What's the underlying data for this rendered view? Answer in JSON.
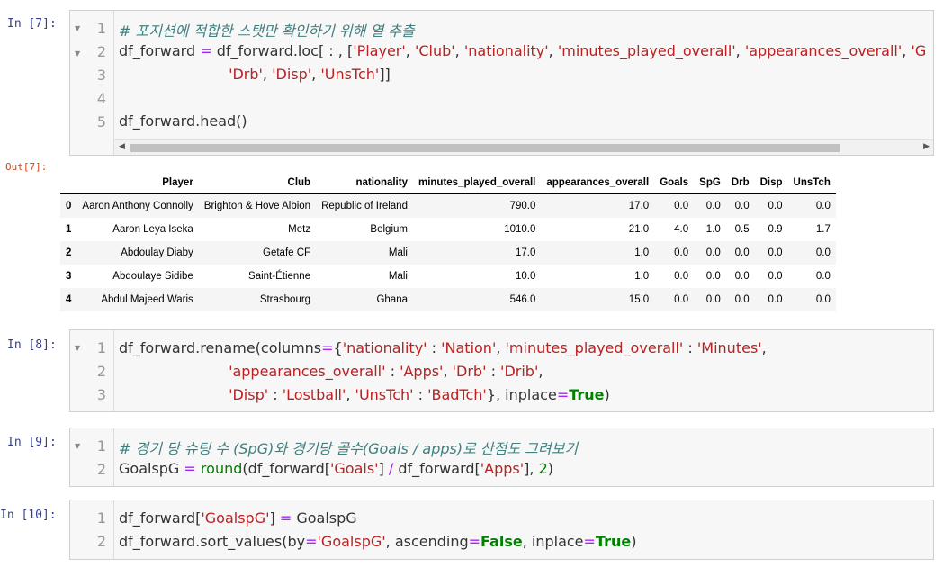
{
  "cells": [
    {
      "prompt": "In [7]:",
      "lines": [
        "# 포지션에 적합한 스탯만 확인하기 위해 열 추출",
        "df_forward = df_forward.loc[ : , ['Player', 'Club', 'nationality', 'minutes_played_overall', 'appearances_overall', 'G",
        "                        'Drb', 'Disp', 'UnsTch']]",
        "",
        "df_forward.head()"
      ],
      "line_numbers": [
        "1",
        "2",
        "3",
        "4",
        "5"
      ]
    },
    {
      "prompt": "In [8]:",
      "lines": [
        "df_forward.rename(columns={'nationality' : 'Nation', 'minutes_played_overall' : 'Minutes',",
        "                        'appearances_overall' : 'Apps', 'Drb' : 'Drib',",
        "                        'Disp' : 'Lostball', 'UnsTch' : 'BadTch'}, inplace=True)"
      ],
      "line_numbers": [
        "1",
        "2",
        "3"
      ]
    },
    {
      "prompt": "In [9]:",
      "lines": [
        "# 경기 당 슈팅 수 (SpG)와 경기당 골수(Goals / apps)로 산점도 그려보기",
        "GoalspG = round(df_forward['Goals'] / df_forward['Apps'], 2)"
      ],
      "line_numbers": [
        "1",
        "2"
      ]
    },
    {
      "prompt": "In [10]:",
      "lines": [
        "df_forward['GoalspG'] = GoalspG",
        "df_forward.sort_values(by='GoalspG', ascending=False, inplace=True)"
      ],
      "line_numbers": [
        "1",
        "2"
      ]
    }
  ],
  "output": {
    "prompt": "Out[7]:",
    "columns": [
      "",
      "Player",
      "Club",
      "nationality",
      "minutes_played_overall",
      "appearances_overall",
      "Goals",
      "SpG",
      "Drb",
      "Disp",
      "UnsTch"
    ],
    "rows": [
      [
        "0",
        "Aaron Anthony Connolly",
        "Brighton & Hove Albion",
        "Republic of Ireland",
        "790.0",
        "17.0",
        "0.0",
        "0.0",
        "0.0",
        "0.0",
        "0.0"
      ],
      [
        "1",
        "Aaron Leya Iseka",
        "Metz",
        "Belgium",
        "1010.0",
        "21.0",
        "4.0",
        "1.0",
        "0.5",
        "0.9",
        "1.7"
      ],
      [
        "2",
        "Abdoulay Diaby",
        "Getafe CF",
        "Mali",
        "17.0",
        "1.0",
        "0.0",
        "0.0",
        "0.0",
        "0.0",
        "0.0"
      ],
      [
        "3",
        "Abdoulaye Sidibe",
        "Saint-Étienne",
        "Mali",
        "10.0",
        "1.0",
        "0.0",
        "0.0",
        "0.0",
        "0.0",
        "0.0"
      ],
      [
        "4",
        "Abdul Majeed Waris",
        "Strasbourg",
        "Ghana",
        "546.0",
        "15.0",
        "0.0",
        "0.0",
        "0.0",
        "0.0",
        "0.0"
      ]
    ]
  }
}
